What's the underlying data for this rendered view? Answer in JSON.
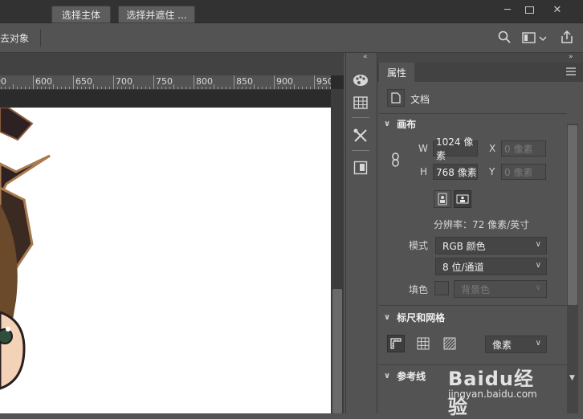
{
  "window": {
    "minimize_icon": "minimize-icon",
    "maximize_icon": "maximize-icon",
    "close_icon": "close-icon"
  },
  "options_bar": {
    "partial_label": "去对象",
    "select_subject": "选择主体",
    "select_and_mask": "选择并遮住 ..."
  },
  "ruler": {
    "labels": [
      "00",
      "600",
      "650",
      "700",
      "750",
      "800",
      "850",
      "900",
      "950"
    ]
  },
  "panel": {
    "tab_label": "属性",
    "doc_label": "文档",
    "canvas_section": "画布",
    "width_label": "W",
    "width_value": "1024 像素",
    "height_label": "H",
    "height_value": "768 像素",
    "x_label": "X",
    "x_placeholder": "0 像素",
    "y_label": "Y",
    "y_placeholder": "0 像素",
    "resolution": "分辨率：72 像素/英寸",
    "mode_label": "模式",
    "mode_value": "RGB 颜色",
    "depth_value": "8 位/通道",
    "fill_label": "填色",
    "fill_value": "背景色",
    "rulers_section": "标尺和网格",
    "unit_value": "像素",
    "guides_section": "参考线"
  },
  "watermark": {
    "brand": "Baidu经验",
    "url": "jingyan.baidu.com"
  },
  "colors": {
    "app_bg": "#535353",
    "titlebar": "#323232",
    "canvas": "#ffffff",
    "field_bg": "#454545"
  }
}
